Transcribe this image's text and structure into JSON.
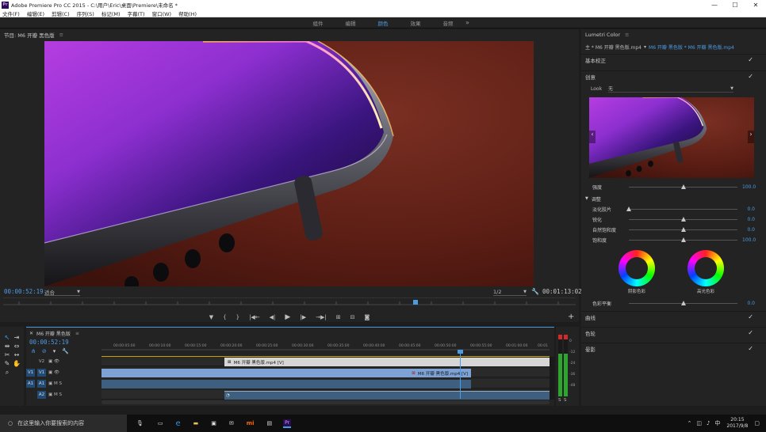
{
  "window": {
    "app_badge": "Pr",
    "title": "Adobe Premiere Pro CC 2015 - C:\\用户\\Eric\\桌面\\Premiere\\未命名 *",
    "controls": [
      "—",
      "☐",
      "✕"
    ]
  },
  "menu": [
    "文件(F)",
    "编辑(E)",
    "剪辑(C)",
    "序列(S)",
    "标记(M)",
    "字幕(T)",
    "窗口(W)",
    "帮助(H)"
  ],
  "workspaces": {
    "tabs": [
      "组件",
      "编辑",
      "颜色",
      "效果",
      "音频"
    ],
    "active": "颜色",
    "more": "»"
  },
  "program_monitor": {
    "title": "节目: M6 开瓣 黑色版",
    "menu_icon": "≡",
    "timecode_current": "00:00:52:19",
    "fit": "适合",
    "resolution": "1/2",
    "timecode_duration": "00:01:13:02",
    "playhead_fraction": 0.72
  },
  "transport": {
    "buttons": [
      "▼",
      "{",
      "}",
      "|◀←",
      "◀|",
      "▶",
      "|▶",
      "→▶|",
      "⊞",
      "⊟",
      "◙"
    ],
    "add": "+"
  },
  "lumetri": {
    "title": "Lumetri Color",
    "menu_icon": "≡",
    "source_tabs": {
      "main": "主 * M6 开瓣 黑色版.mp4",
      "arrow": "▾",
      "clip": "M6 开瓣 黑色版 * M6 开瓣 黑色版.mp4"
    },
    "sections": {
      "basic": "基本校正",
      "creative": "创意",
      "curves": "曲线",
      "wheels": "色轮",
      "vignette": "晕影"
    },
    "look_label": "Look",
    "look_value": "无",
    "intensity_label": "强度",
    "intensity_value": "100.0",
    "intensity_fraction": 0.5,
    "adjust_label": "调整",
    "adjust_sliders": [
      {
        "label": "淡化胶片",
        "value": "0.0",
        "fraction": 0.0
      },
      {
        "label": "锐化",
        "value": "0.0",
        "fraction": 0.5
      },
      {
        "label": "自然饱和度",
        "value": "0.0",
        "fraction": 0.5
      },
      {
        "label": "饱和度",
        "value": "100.0",
        "fraction": 0.5
      }
    ],
    "shadow_tint": "阴影色彩",
    "highlight_tint": "高光色彩",
    "tint_balance_label": "色彩平衡",
    "tint_balance_value": "0.0",
    "tint_balance_fraction": 0.5,
    "check": "✓"
  },
  "timeline": {
    "tab_title": "M6 开瓣 黑色版",
    "menu_icon": "≡",
    "timecode": "00:00:52:19",
    "ruler_labels": [
      "00:00:05:00",
      "00:00:10:00",
      "00:00:15:00",
      "00:00:20:00",
      "00:00:25:00",
      "00:00:30:00",
      "00:00:35:00",
      "00:00:40:00",
      "00:00:45:00",
      "00:00:50:00",
      "00:00:55:00",
      "00:01:00:00",
      "00:01"
    ],
    "playhead_fraction": 0.8,
    "tracks": [
      {
        "source": "",
        "name": "V2",
        "icons": "▣ 👁"
      },
      {
        "source": "V1",
        "name": "V1",
        "icons": "▣ 👁"
      },
      {
        "source": "A1",
        "name": "A1",
        "icons": "▣ M S"
      },
      {
        "source": "",
        "name": "A2",
        "icons": "▣ M S"
      }
    ],
    "clip_v2_label": "M6 开瓣 黑色版.mp4 [V]",
    "clip_v1_label": "M6 开瓣 黑色版.mp4 [V]"
  },
  "meters": {
    "labels": [
      "0",
      "-12",
      "-24",
      "-36",
      "-48"
    ],
    "solo": "S",
    "solo2": "S"
  },
  "taskbar": {
    "search_placeholder": "在这里输入你要搜索的内容",
    "time": "20:15",
    "date": "2017/9/8"
  }
}
